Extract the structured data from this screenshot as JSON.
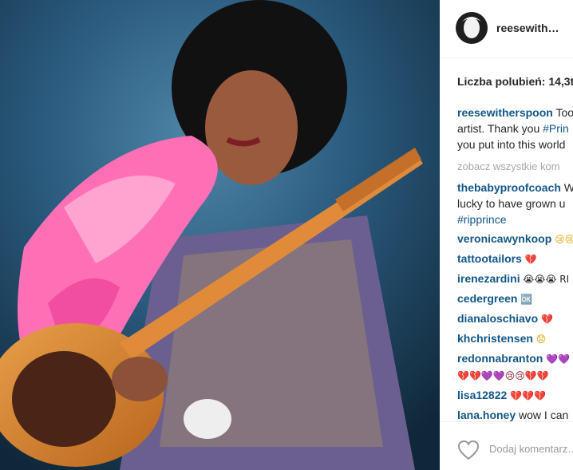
{
  "post": {
    "username": "reesewith…",
    "likes_text": "Liczba polubień: 14,3t",
    "caption": {
      "user": "reesewitherspoon",
      "lines": [
        "Too",
        "artist. Thank you ",
        "#Prin",
        "you put into this world"
      ]
    },
    "view_all": "zobacz wszystkie kom",
    "comments": [
      {
        "user": "thebabyproofcoach",
        "text": " W",
        "text2": "lucky to have grown u",
        "hashtag": "#ripprince"
      },
      {
        "user": "veronicawynkoop",
        "text": " 😢😢"
      },
      {
        "user": "tattootailors",
        "text": " 💔"
      },
      {
        "user": "irenezardini",
        "text": " 😭😭😭 RI"
      },
      {
        "user": "cedergreen",
        "text": " 🆗"
      },
      {
        "user": "dianaloschiavo",
        "text": " 💔"
      },
      {
        "user": "khchristensen",
        "text": " 😞"
      },
      {
        "user": "redonnabranton",
        "text": " 💜💜",
        "text2": "💔💔💜💜😢😢💔💔"
      },
      {
        "user": "lisa12822",
        "text": " 💔💔💔"
      },
      {
        "user": "lana.honey",
        "text": " wow I can"
      }
    ],
    "add_comment_placeholder": "Dodaj komentarz…"
  },
  "colors": {
    "link": "#125688",
    "text": "#262626",
    "muted": "#a5a7aa",
    "border": "#efefef"
  },
  "icons": {
    "like": "heart-outline-icon"
  }
}
